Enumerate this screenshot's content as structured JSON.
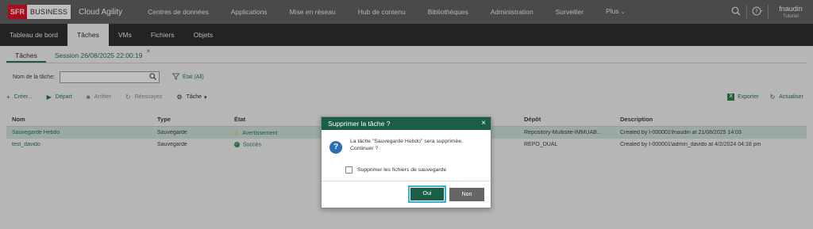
{
  "topbar": {
    "logo_sfr": "SFR",
    "logo_business": "BUSINESS",
    "brand": "Cloud Agility",
    "nav": [
      {
        "label": "Centres de données"
      },
      {
        "label": "Applications"
      },
      {
        "label": "Mise en réseau"
      },
      {
        "label": "Hub de contenu"
      },
      {
        "label": "Bibliothèques"
      },
      {
        "label": "Administration"
      },
      {
        "label": "Surveiller"
      },
      {
        "label": "Plus"
      }
    ],
    "user_name": "fnaudin",
    "user_role": "Tutoriel"
  },
  "subnav": {
    "tabs": [
      {
        "label": "Tableau de bord"
      },
      {
        "label": "Tâches"
      },
      {
        "label": "VMs"
      },
      {
        "label": "Fichiers"
      },
      {
        "label": "Objets"
      }
    ],
    "active_index": 1
  },
  "pagetabs": {
    "tasks": "Tâches",
    "session": "Session 26/08/2025 22:00:19",
    "close": "×"
  },
  "filter": {
    "label": "Nom de la tâche:",
    "value": "",
    "etat_label": "État (All)"
  },
  "toolbar": {
    "create": "Créer...",
    "start": "Départ",
    "stop": "Arrêter",
    "retry": "Réessayez",
    "task": "Tâche",
    "export": "Exporter",
    "refresh": "Actualiser"
  },
  "table": {
    "headers": [
      "Nom",
      "Type",
      "État",
      "",
      "Dépôt",
      "Description"
    ],
    "rows": [
      {
        "name": "Sauvegarde Hebdo",
        "type": "Sauvegarde",
        "state": "Avertissement",
        "depot": "Repository-Multisite-IMMUAB...",
        "description": "Created by I-000001\\fnaudin at 21/08/2025 14:03",
        "selected": true
      },
      {
        "name": "test_davido",
        "type": "Sauvegarde",
        "state": "Succès",
        "depot": "REPO_DUAL",
        "description": "Created by I-000001\\admin_davido at 4/2/2024 04:18 pm",
        "selected": false
      }
    ]
  },
  "dialog": {
    "title": "Supprimer la tâche ?",
    "close": "×",
    "message": "La tâche \"Sauvegarde Hebdo\" sera supprimée. Continuer ?",
    "checkbox_label": "Supprimer les fichiers de sauvegarde",
    "checkbox_checked": false,
    "yes": "Oui",
    "no": "Non"
  },
  "colors": {
    "accent": "#1d6b56",
    "dialog_header": "#1a5e48",
    "highlight": "#3bb0d6",
    "topbar": "#5a5a5a",
    "subbar": "#222222",
    "selected_row": "#cfe3da"
  }
}
